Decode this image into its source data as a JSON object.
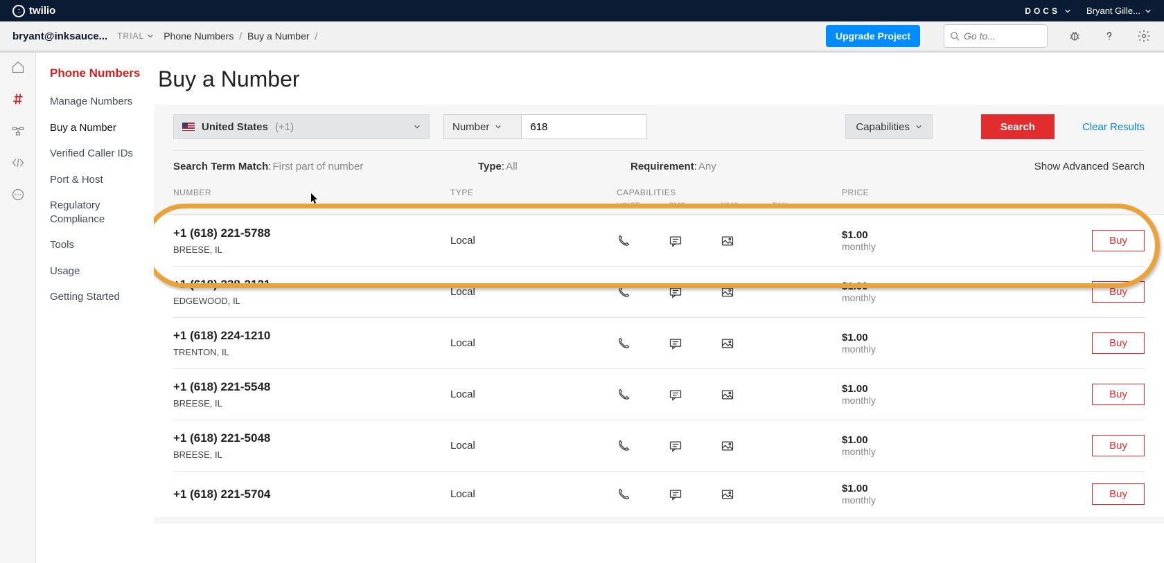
{
  "header": {
    "brand": "twilio",
    "docs": "DOCS",
    "user": "Bryant Gille..."
  },
  "subheader": {
    "account": "bryant@inksauce...",
    "trial": "TRIAL",
    "crumbs": [
      "Phone Numbers",
      "Buy a Number"
    ],
    "upgrade": "Upgrade Project",
    "search_placeholder": "Go to..."
  },
  "sidebar": {
    "title": "Phone Numbers",
    "items": [
      {
        "label": "Manage Numbers",
        "active": false
      },
      {
        "label": "Buy a Number",
        "active": true
      },
      {
        "label": "Verified Caller IDs",
        "active": false
      },
      {
        "label": "Port & Host",
        "active": false
      },
      {
        "label": "Regulatory Compliance",
        "active": false
      },
      {
        "label": "Tools",
        "active": false
      },
      {
        "label": "Usage",
        "active": false
      },
      {
        "label": "Getting Started",
        "active": false
      }
    ]
  },
  "page": {
    "title": "Buy a Number",
    "filters": {
      "country_name": "United States",
      "country_code": "(+1)",
      "field_label": "Number",
      "field_value": "618",
      "capabilities": "Capabilities",
      "search": "Search",
      "clear": "Clear Results"
    },
    "meta": {
      "match_k": "Search Term Match",
      "match_v": "First part of number",
      "type_k": "Type",
      "type_v": "All",
      "req_k": "Requirement",
      "req_v": "Any",
      "advanced": "Show Advanced Search"
    },
    "columns": {
      "number": "NUMBER",
      "type": "TYPE",
      "cap": "CAPABILITIES",
      "price": "PRICE",
      "voice": "VOICE",
      "sms": "SMS",
      "mms": "MMS",
      "fax": "FAX"
    },
    "rows": [
      {
        "number": "+1 (618) 221-5788",
        "loc": "BREESE, IL",
        "type": "Local",
        "price": "$1.00",
        "period": "monthly",
        "buy": "Buy"
      },
      {
        "number": "+1 (618) 238-2121",
        "loc": "EDGEWOOD, IL",
        "type": "Local",
        "price": "$1.00",
        "period": "monthly",
        "buy": "Buy"
      },
      {
        "number": "+1 (618) 224-1210",
        "loc": "TRENTON, IL",
        "type": "Local",
        "price": "$1.00",
        "period": "monthly",
        "buy": "Buy"
      },
      {
        "number": "+1 (618) 221-5548",
        "loc": "BREESE, IL",
        "type": "Local",
        "price": "$1.00",
        "period": "monthly",
        "buy": "Buy"
      },
      {
        "number": "+1 (618) 221-5048",
        "loc": "BREESE, IL",
        "type": "Local",
        "price": "$1.00",
        "period": "monthly",
        "buy": "Buy"
      },
      {
        "number": "+1 (618) 221-5704",
        "loc": "",
        "type": "Local",
        "price": "$1.00",
        "period": "monthly",
        "buy": "Buy"
      }
    ]
  }
}
